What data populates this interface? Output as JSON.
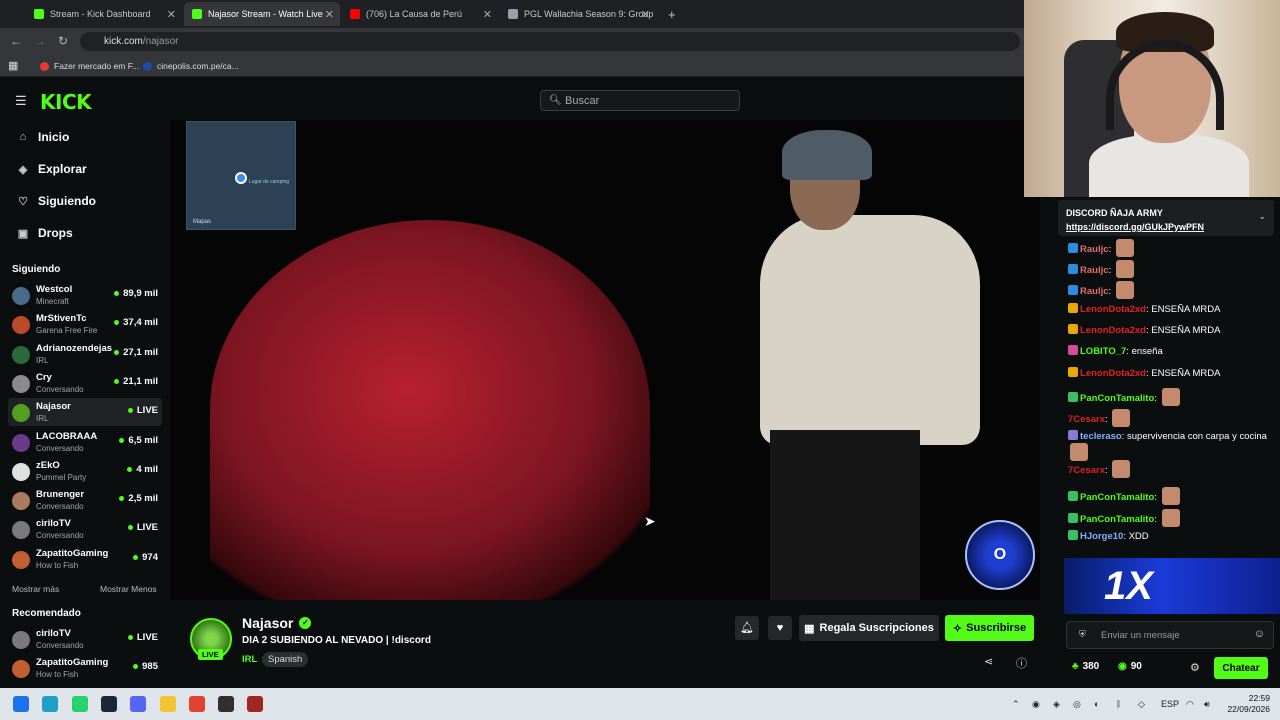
{
  "browser": {
    "tabs": [
      {
        "title": "Stream - Kick Dashboard",
        "favicon_color": "#53fc18"
      },
      {
        "title": "Najasor Stream - Watch Live",
        "favicon_color": "#53fc18"
      },
      {
        "title": "(706) La Causa de Perú",
        "favicon_color": "#ff0000"
      },
      {
        "title": "PGL Wallachia Season 9: Group",
        "favicon_color": "#9aa0a6"
      }
    ],
    "url_host": "kick.com",
    "url_path": "/najasor",
    "bookmarks": [
      {
        "label": "Fazer mercado em F...",
        "color": "#e53935"
      },
      {
        "label": "cinepolis.com.pe/ca...",
        "color": "#1e4aa8"
      }
    ]
  },
  "kick": {
    "logo": "KICK",
    "search_placeholder": "Buscar",
    "accent": "#53fc18"
  },
  "sidebar": {
    "nav": [
      {
        "label": "Inicio",
        "icon": "home-icon"
      },
      {
        "label": "Explorar",
        "icon": "compass-icon"
      },
      {
        "label": "Siguiendo",
        "icon": "heart-icon"
      },
      {
        "label": "Drops",
        "icon": "gift-icon"
      }
    ],
    "following_title": "Siguiendo",
    "following": [
      {
        "name": "Westcol",
        "category": "Minecraft",
        "viewers": "89,9 mil",
        "avatar": "#4a6a8a"
      },
      {
        "name": "MrStivenTc",
        "category": "Garena Free Fire",
        "viewers": "37,4 mil",
        "avatar": "#b84a2a"
      },
      {
        "name": "Adrianozendejas",
        "category": "IRL",
        "viewers": "27,1 mil",
        "avatar": "#2a6a3a"
      },
      {
        "name": "Cry",
        "category": "Conversando",
        "viewers": "21,1 mil",
        "avatar": "#8a8a8a"
      },
      {
        "name": "Najasor",
        "category": "IRL",
        "viewers": "LIVE",
        "avatar": "#53a020"
      },
      {
        "name": "LACOBRAAA",
        "category": "Conversando",
        "viewers": "6,5 mil",
        "avatar": "#6a3a8a"
      },
      {
        "name": "zEkO",
        "category": "Pummel Party",
        "viewers": "4 mil",
        "avatar": "#e0e0e0"
      },
      {
        "name": "Brunenger",
        "category": "Conversando",
        "viewers": "2,5 mil",
        "avatar": "#aa7a5a"
      },
      {
        "name": "ciriloTV",
        "category": "Conversando",
        "viewers": "LIVE",
        "avatar": "#7a7a7a"
      },
      {
        "name": "ZapatitoGaming",
        "category": "How to Fish",
        "viewers": "974",
        "avatar": "#c06030"
      }
    ],
    "show_more": "Mostrar más",
    "show_less": "Mostrar Menos",
    "recommended_title": "Recomendado",
    "recommended": [
      {
        "name": "ciriloTV",
        "category": "Conversando",
        "viewers": "LIVE",
        "avatar": "#7a7a7a"
      },
      {
        "name": "ZapatitoGaming",
        "category": "How to Fish",
        "viewers": "985",
        "avatar": "#c06030"
      }
    ]
  },
  "video": {
    "minimap_label": "Lugar de camping",
    "minimap_brand": "Mapas",
    "overlay_badge": "O"
  },
  "stream": {
    "streamer": "Najasor",
    "live_label": "LIVE",
    "title": "DIA 2 SUBIENDO AL NEVADO | !discord",
    "category": "IRL",
    "language": "Spanish",
    "gift_label": "Regala Suscripciones",
    "subscribe_label": "Suscribirse"
  },
  "chat": {
    "pinned_title": "DISCORD ÑAJA ARMY",
    "pinned_link": "https://discord.gg/GUkJPywPFN",
    "messages": [
      {
        "user": "Rauljc",
        "color": "#e06c6c",
        "text": "",
        "emote": true,
        "badge": "#2e8be0"
      },
      {
        "user": "Rauljc",
        "color": "#e06c6c",
        "text": "",
        "emote": true,
        "badge": "#2e8be0"
      },
      {
        "user": "Rauljc",
        "color": "#e06c6c",
        "text": "",
        "emote": true,
        "badge": "#2e8be0"
      },
      {
        "user": "LenonDota2xd",
        "color": "#e02020",
        "text": "ENSEÑA MRDA",
        "emote": false,
        "badge": "#e8a800"
      },
      {
        "user": "LenonDota2xd",
        "color": "#e02020",
        "text": "ENSEÑA MRDA",
        "emote": false,
        "badge": "#e8a800"
      },
      {
        "user": "LOBITO_7",
        "color": "#53fc18",
        "text": "enseña",
        "emote": false,
        "badge": "#d84a9a"
      },
      {
        "user": "LenonDota2xd",
        "color": "#e02020",
        "text": "ENSEÑA MRDA",
        "emote": false,
        "badge": "#e8a800"
      },
      {
        "user": "PanConTamalito",
        "color": "#53fc18",
        "text": "",
        "emote": true,
        "badge": "#3ac060"
      },
      {
        "user": "7Cesarx",
        "color": "#e02020",
        "text": "",
        "emote": true,
        "badge": ""
      },
      {
        "user": "tecleraso",
        "color": "#7fb0ff",
        "text": "supervivencia con carpa y cocina",
        "emote": true,
        "badge": "#8a7ad8"
      },
      {
        "user": "7Cesarx",
        "color": "#e02020",
        "text": "",
        "emote": true,
        "badge": ""
      },
      {
        "user": "PanConTamalito",
        "color": "#53fc18",
        "text": "",
        "emote": true,
        "badge": "#3ac060"
      },
      {
        "user": "PanConTamalito",
        "color": "#53fc18",
        "text": "",
        "emote": true,
        "badge": "#3ac060"
      },
      {
        "user": "HJorge10",
        "color": "#7fb0ff",
        "text": "XDD",
        "emote": false,
        "badge": "#3ac060"
      }
    ],
    "promo_text": "1X",
    "input_placeholder": "Enviar un mensaje",
    "points": "380",
    "coins": "90",
    "send_label": "Chatear"
  },
  "taskbar": {
    "apps": [
      {
        "name": "windows-start",
        "color": "#1a73e8"
      },
      {
        "name": "edge",
        "color": "#1fa0c8"
      },
      {
        "name": "whatsapp",
        "color": "#25d366"
      },
      {
        "name": "steam",
        "color": "#1b2838"
      },
      {
        "name": "discord",
        "color": "#5865f2"
      },
      {
        "name": "file-explorer",
        "color": "#f4c430"
      },
      {
        "name": "chrome",
        "color": "#e34133"
      },
      {
        "name": "obs",
        "color": "#303030"
      },
      {
        "name": "dota2",
        "color": "#a0271e"
      }
    ],
    "language": "ESP",
    "time": "22:59",
    "date": "22/09/2026"
  }
}
